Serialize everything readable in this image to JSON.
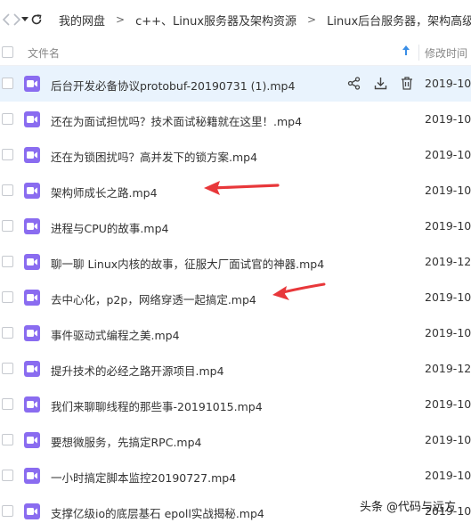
{
  "breadcrumb": {
    "items": [
      "我的网盘",
      "c++、Linux服务器及架构资源",
      "Linux后台服务器，架构高级"
    ],
    "separator": ">"
  },
  "table": {
    "col_name": "文件名",
    "col_time": "修改时间",
    "rows": [
      {
        "name": "后台开发必备协议protobuf-20190731 (1).mp4",
        "time": "2019-10-",
        "selected": true
      },
      {
        "name": "还在为面试担忧吗？技术面试秘籍就在这里！.mp4",
        "time": "2019-10-"
      },
      {
        "name": "还在为锁困扰吗？高并发下的锁方案.mp4",
        "time": "2019-10-"
      },
      {
        "name": "架构师成长之路.mp4",
        "time": "2019-10-"
      },
      {
        "name": "进程与CPU的故事.mp4",
        "time": "2019-10-"
      },
      {
        "name": "聊一聊 Linux内核的故事，征服大厂面试官的神器.mp4",
        "time": "2019-12-"
      },
      {
        "name": "去中心化，p2p，网络穿透一起搞定.mp4",
        "time": "2019-10-"
      },
      {
        "name": "事件驱动式编程之美.mp4",
        "time": "2019-10-"
      },
      {
        "name": "提升技术的必经之路开源项目.mp4",
        "time": "2019-12-"
      },
      {
        "name": "我们来聊聊线程的那些事-20191015.mp4",
        "time": "2019-10-"
      },
      {
        "name": "要想微服务，先搞定RPC.mp4",
        "time": "2019-10-"
      },
      {
        "name": "一小时搞定脚本监控20190727.mp4",
        "time": "2019-10-"
      },
      {
        "name": "支撑亿级io的底层基石 epoll实战揭秘.mp4",
        "time": "2019-10-"
      }
    ]
  },
  "icons": {
    "back": "chevron-left-icon",
    "forward": "chevron-right-icon",
    "history": "dropdown-icon",
    "refresh": "refresh-icon",
    "sort": "sort-up-icon",
    "file": "video-file-icon",
    "share": "share-icon",
    "download": "download-icon",
    "delete": "trash-icon"
  },
  "colors": {
    "selected_row": "#e9f3fd",
    "video_icon": "#8a6cf0",
    "annotation_arrow": "#e8373a",
    "sort_accent": "#3a8ee6"
  },
  "watermark": {
    "prefix": "头条",
    "handle": "@代码与远方"
  }
}
